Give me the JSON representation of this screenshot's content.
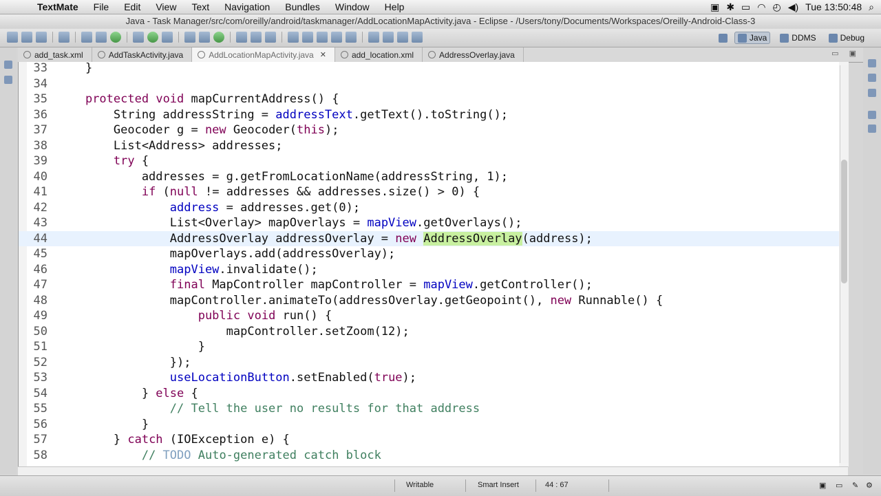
{
  "menubar": {
    "app": "TextMate",
    "items": [
      "File",
      "Edit",
      "View",
      "Text",
      "Navigation",
      "Bundles",
      "Window",
      "Help"
    ],
    "clock": "Tue 13:50:48"
  },
  "window": {
    "title": "Java - Task Manager/src/com/oreilly/android/taskmanager/AddLocationMapActivity.java - Eclipse - /Users/tony/Documents/Workspaces/Oreilly-Android-Class-3"
  },
  "perspectives": {
    "java": "Java",
    "ddms": "DDMS",
    "debug": "Debug"
  },
  "tabs": [
    {
      "label": "add_task.xml",
      "active": false
    },
    {
      "label": "AddTaskActivity.java",
      "active": false
    },
    {
      "label": "AddLocationMapActivity.java",
      "active": true
    },
    {
      "label": "add_location.xml",
      "active": false
    },
    {
      "label": "AddressOverlay.java",
      "active": false
    }
  ],
  "editor": {
    "current_line": 44,
    "lines": [
      {
        "n": "33",
        "text": "    }"
      },
      {
        "n": "34",
        "text": ""
      },
      {
        "n": "35",
        "text": "    protected void mapCurrentAddress() {"
      },
      {
        "n": "36",
        "text": "        String addressString = addressText.getText().toString();"
      },
      {
        "n": "37",
        "text": "        Geocoder g = new Geocoder(this);"
      },
      {
        "n": "38",
        "text": "        List<Address> addresses;"
      },
      {
        "n": "39",
        "text": "        try {"
      },
      {
        "n": "40",
        "text": "            addresses = g.getFromLocationName(addressString, 1);"
      },
      {
        "n": "41",
        "text": "            if (null != addresses && addresses.size() > 0) {"
      },
      {
        "n": "42",
        "text": "                address = addresses.get(0);"
      },
      {
        "n": "43",
        "text": "                List<Overlay> mapOverlays = mapView.getOverlays();"
      },
      {
        "n": "44",
        "text": "                AddressOverlay addressOverlay = new AddressOverlay(address);"
      },
      {
        "n": "45",
        "text": "                mapOverlays.add(addressOverlay);"
      },
      {
        "n": "46",
        "text": "                mapView.invalidate();"
      },
      {
        "n": "47",
        "text": "                final MapController mapController = mapView.getController();"
      },
      {
        "n": "48",
        "text": "                mapController.animateTo(addressOverlay.getGeopoint(), new Runnable() {"
      },
      {
        "n": "49",
        "text": "                    public void run() {"
      },
      {
        "n": "50",
        "text": "                        mapController.setZoom(12);"
      },
      {
        "n": "51",
        "text": "                    }"
      },
      {
        "n": "52",
        "text": "                });"
      },
      {
        "n": "53",
        "text": "                useLocationButton.setEnabled(true);"
      },
      {
        "n": "54",
        "text": "            } else {"
      },
      {
        "n": "55",
        "text": "                // Tell the user no results for that address"
      },
      {
        "n": "56",
        "text": "            }"
      },
      {
        "n": "57",
        "text": "        } catch (IOException e) {"
      },
      {
        "n": "58",
        "text": "            // TODO Auto-generated catch block"
      }
    ]
  },
  "status": {
    "writable": "Writable",
    "insert_mode": "Smart Insert",
    "position": "44 : 67"
  },
  "colors": {
    "keyword": "#7f0055",
    "field": "#0000c0",
    "comment": "#3f7f5f",
    "todo": "#7f9fbf",
    "current_line": "#e8f2fe",
    "occurrence_highlight": "#c8f0a0"
  }
}
